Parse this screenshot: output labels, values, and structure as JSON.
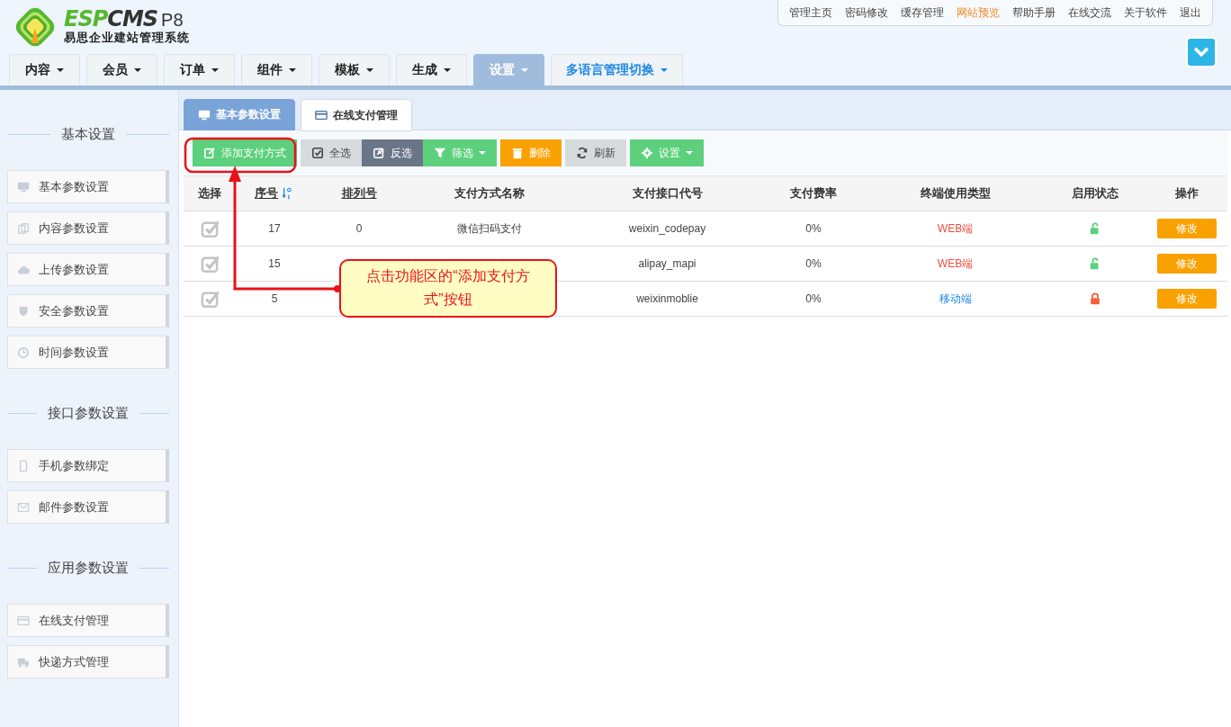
{
  "logo": {
    "brand_parts": [
      {
        "text": "ESP",
        "kind": "accent"
      },
      {
        "text": "CMS",
        "kind": "dark"
      }
    ],
    "version": "P8",
    "subtitle": "易思企业建站管理系统"
  },
  "top_links": [
    {
      "label": "管理主页",
      "highlighted": false
    },
    {
      "label": "密码修改",
      "highlighted": false
    },
    {
      "label": "缓存管理",
      "highlighted": false
    },
    {
      "label": "网站预览",
      "highlighted": true
    },
    {
      "label": "帮助手册",
      "highlighted": false
    },
    {
      "label": "在线交流",
      "highlighted": false
    },
    {
      "label": "关于软件",
      "highlighted": false
    },
    {
      "label": "退出",
      "highlighted": false
    }
  ],
  "nav_tabs": [
    {
      "label": "内容",
      "selected": false,
      "kind": "menu"
    },
    {
      "label": "会员",
      "selected": false,
      "kind": "menu"
    },
    {
      "label": "订单",
      "selected": false,
      "kind": "menu"
    },
    {
      "label": "组件",
      "selected": false,
      "kind": "menu"
    },
    {
      "label": "模板",
      "selected": false,
      "kind": "menu"
    },
    {
      "label": "生成",
      "selected": false,
      "kind": "menu"
    },
    {
      "label": "设置",
      "selected": true,
      "kind": "menu"
    },
    {
      "label": "多语言管理切换",
      "selected": false,
      "kind": "language"
    }
  ],
  "sidebar": {
    "sections": [
      {
        "title": "基本设置",
        "items": [
          {
            "label": "基本参数设置"
          },
          {
            "label": "内容参数设置"
          },
          {
            "label": "上传参数设置"
          },
          {
            "label": "安全参数设置"
          },
          {
            "label": "时间参数设置"
          }
        ]
      },
      {
        "title": "接口参数设置",
        "items": [
          {
            "label": "手机参数绑定"
          },
          {
            "label": "邮件参数设置"
          }
        ]
      },
      {
        "title": "应用参数设置",
        "items": [
          {
            "label": "在线支付管理"
          },
          {
            "label": "快递方式管理"
          }
        ]
      }
    ]
  },
  "content_tabs": [
    {
      "label": "基本参数设置",
      "selected": false
    },
    {
      "label": "在线支付管理",
      "selected": true
    }
  ],
  "toolbar": [
    {
      "label": "添加支付方式",
      "kind": "success",
      "dropdown": false
    },
    {
      "label": "全选",
      "kind": "light",
      "dropdown": false
    },
    {
      "label": "反选",
      "kind": "dark",
      "dropdown": false
    },
    {
      "label": "筛选",
      "kind": "success",
      "dropdown": true
    },
    {
      "label": "删除",
      "kind": "warning",
      "dropdown": false
    },
    {
      "label": "刷新",
      "kind": "light",
      "dropdown": false
    },
    {
      "label": "设置",
      "kind": "success",
      "dropdown": true
    }
  ],
  "table": {
    "columns": [
      {
        "label": "选择",
        "sortable": false,
        "sorted": false
      },
      {
        "label": "序号",
        "sortable": true,
        "sorted": true
      },
      {
        "label": "排列号",
        "sortable": true,
        "sorted": false
      },
      {
        "label": "支付方式名称",
        "sortable": false,
        "sorted": false
      },
      {
        "label": "支付接口代号",
        "sortable": false,
        "sorted": false
      },
      {
        "label": "支付费率",
        "sortable": false,
        "sorted": false
      },
      {
        "label": "终端使用类型",
        "sortable": false,
        "sorted": false
      },
      {
        "label": "启用状态",
        "sortable": false,
        "sorted": false
      },
      {
        "label": "操作",
        "sortable": false,
        "sorted": false
      }
    ],
    "rows": [
      {
        "id": "17",
        "sort": "0",
        "name": "微信扫码支付",
        "code": "weixin_codepay",
        "rate": "0%",
        "terminal": {
          "label": "WEB端",
          "kind": "web"
        },
        "enabled": true,
        "action": "修改"
      },
      {
        "id": "15",
        "code": "alipay_mapi",
        "rate": "0%",
        "terminal": {
          "label": "WEB端",
          "kind": "web"
        },
        "enabled": true,
        "action": "修改"
      },
      {
        "id": "5",
        "code": "weixinmoblie",
        "rate": "0%",
        "terminal": {
          "label": "移动端",
          "kind": "mobile"
        },
        "enabled": false,
        "action": "修改"
      }
    ]
  },
  "callout": {
    "text": "点击功能区的“添加支付方式”按钮"
  }
}
